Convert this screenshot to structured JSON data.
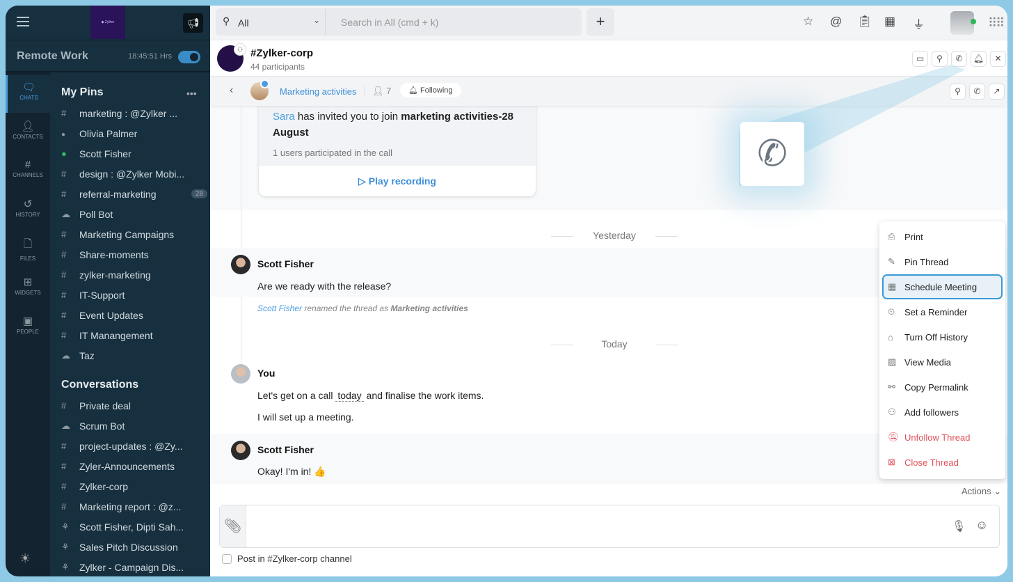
{
  "sidebar": {
    "workspace_logo": "Zylker Technologies",
    "status_title": "Remote Work",
    "status_time": "18:45:51 Hrs",
    "status_toggle_on": true,
    "rail": [
      {
        "label": "CHATS",
        "icon": "chat-icon",
        "active": true
      },
      {
        "label": "CONTACTS",
        "icon": "person-icon"
      },
      {
        "label": "CHANNELS",
        "icon": "hash-icon"
      },
      {
        "label": "HISTORY",
        "icon": "history-icon"
      },
      {
        "label": "FILES",
        "icon": "file-icon"
      },
      {
        "label": "WIDGETS",
        "icon": "widgets-icon"
      },
      {
        "label": "PEOPLE",
        "icon": "people-icon"
      }
    ],
    "pins_title": "My Pins",
    "pins": [
      {
        "label": "marketing : @Zylker ...",
        "type": "#"
      },
      {
        "label": "Olivia Palmer",
        "type": "offline"
      },
      {
        "label": "Scott Fisher",
        "type": "online"
      },
      {
        "label": "design : @Zylker Mobi...",
        "type": "#"
      },
      {
        "label": "referral-marketing",
        "type": "#",
        "badge": "28"
      },
      {
        "label": "Poll Bot",
        "type": "bot"
      },
      {
        "label": "Marketing Campaigns",
        "type": "#"
      },
      {
        "label": "Share-moments",
        "type": "#"
      },
      {
        "label": "zylker-marketing",
        "type": "#"
      },
      {
        "label": "IT-Support",
        "type": "#"
      },
      {
        "label": "Event Updates",
        "type": "#"
      },
      {
        "label": "IT Manangement",
        "type": "#"
      },
      {
        "label": "Taz",
        "type": "bot"
      }
    ],
    "conv_title": "Conversations",
    "conversations": [
      {
        "label": "Private deal",
        "type": "#"
      },
      {
        "label": "Scrum Bot",
        "type": "bot"
      },
      {
        "label": "project-updates : @Zy...",
        "type": "#"
      },
      {
        "label": "Zyler-Announcements",
        "type": "#"
      },
      {
        "label": "Zylker-corp",
        "type": "#"
      },
      {
        "label": "Marketing report : @z...",
        "type": "#"
      },
      {
        "label": "Scott Fisher, Dipti Sah...",
        "type": "group"
      },
      {
        "label": "Sales Pitch Discussion",
        "type": "group"
      },
      {
        "label": "Zylker - Campaign Dis...",
        "type": "group"
      }
    ]
  },
  "topbar": {
    "search_scope": "All",
    "search_placeholder": "Search in All (cmd + k)"
  },
  "channel": {
    "name": "#Zylker-corp",
    "participants": "44 participants"
  },
  "thread": {
    "name": "Marketing activities",
    "members": "7",
    "follow_label": "Following"
  },
  "call_card": {
    "inviter": "Sara",
    "text": " has invited you to join ",
    "meeting": "marketing activities-28 August",
    "participants": "1 users participated in the call",
    "play": "Play recording"
  },
  "days": {
    "yesterday": "Yesterday",
    "today": "Today"
  },
  "messages": [
    {
      "author": "Scott Fisher",
      "text": "Are we ready with the release?"
    },
    {
      "system_user": "Scott Fisher",
      "system_text": " renamed the thread as ",
      "system_target": "Marketing activities"
    },
    {
      "author": "You",
      "text_a": "Let's get on a call ",
      "text_b": "today",
      "text_c": " and finalise the work items.",
      "text2": "I will set up a meeting."
    },
    {
      "author": "Scott Fisher",
      "text": "Okay! I'm in! 👍"
    }
  ],
  "menu": [
    {
      "label": "Print",
      "icon": "printer-icon"
    },
    {
      "label": "Pin Thread",
      "icon": "pin-icon"
    },
    {
      "label": "Schedule Meeting",
      "icon": "calendar-icon",
      "highlighted": true
    },
    {
      "label": "Set a Reminder",
      "icon": "reminder-icon"
    },
    {
      "label": "Turn Off History",
      "icon": "incognito-icon"
    },
    {
      "label": "View Media",
      "icon": "media-icon"
    },
    {
      "label": "Copy Permalink",
      "icon": "link-icon"
    },
    {
      "label": "Add followers",
      "icon": "add-user-icon"
    },
    {
      "label": "Unfollow Thread",
      "icon": "bell-off-icon",
      "danger": true
    },
    {
      "label": "Close Thread",
      "icon": "close-thread-icon",
      "danger": true
    }
  ],
  "actions_label": "Actions",
  "composer": {
    "post_in_channel": "Post in #Zylker-corp channel",
    "checked": false
  },
  "colors": {
    "accent": "#3d8fd9",
    "sidebar": "#17303f",
    "danger": "#e0505a",
    "frame": "#8ecae6"
  }
}
